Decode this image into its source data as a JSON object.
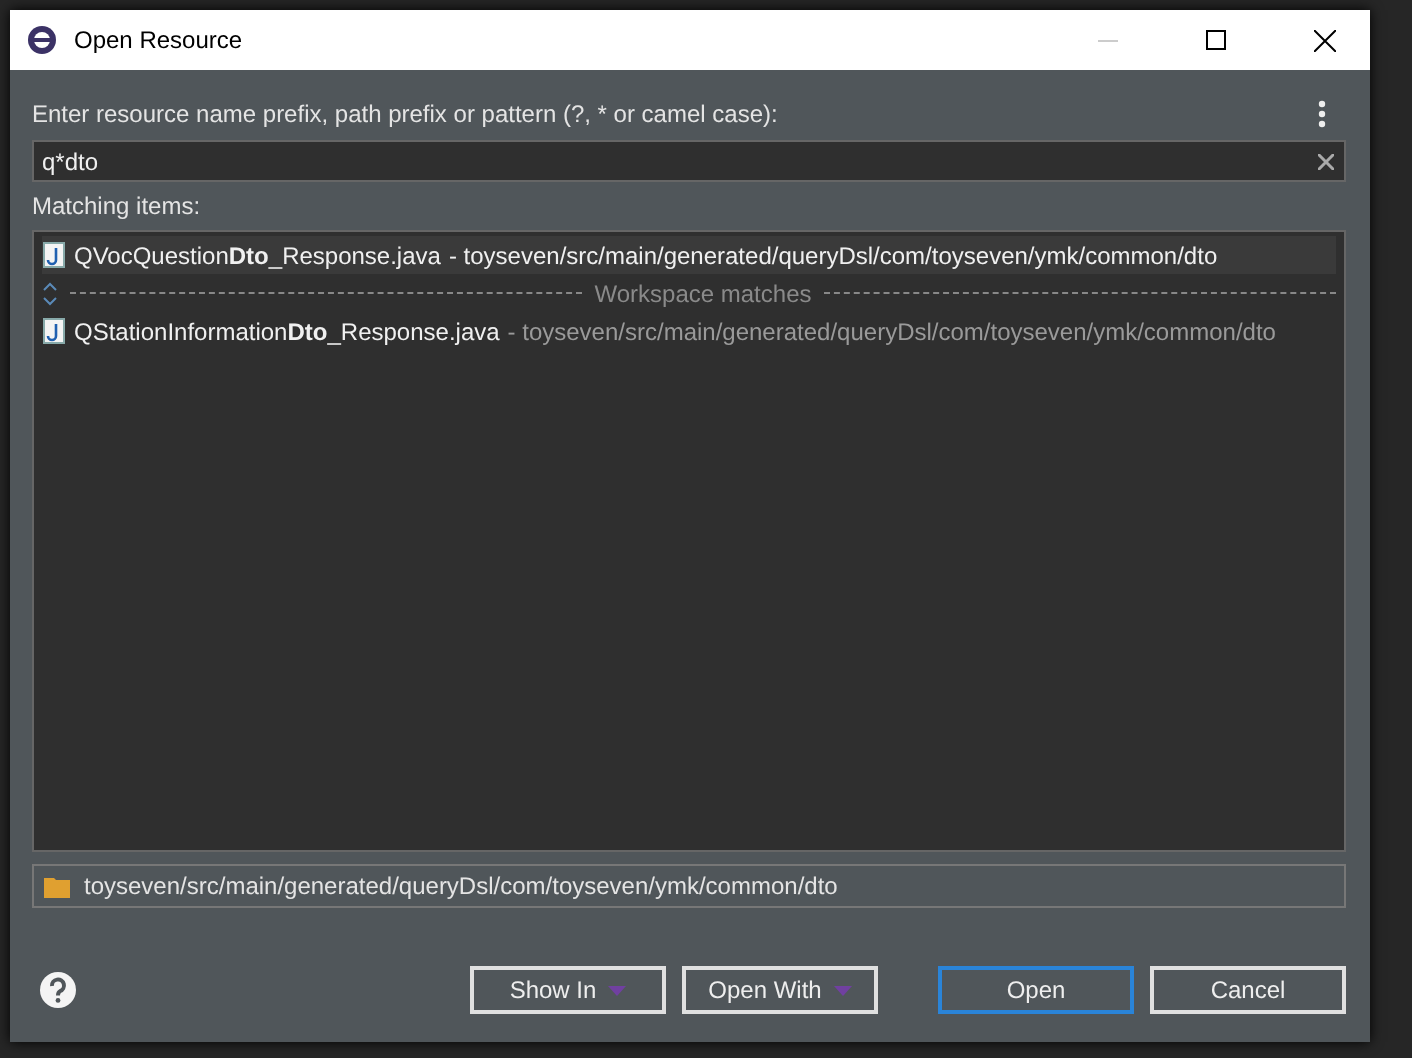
{
  "window": {
    "title": "Open Resource"
  },
  "prompt": "Enter resource name prefix, path prefix or pattern (?, * or camel case):",
  "search": {
    "value": "q*dto"
  },
  "matching_label": "Matching items:",
  "items": [
    {
      "kind": "match",
      "name": "QVocQuestion**Dto**_Response.java",
      "path": "- toyseven/src/main/generated/queryDsl/com/toyseven/ymk/common/dto",
      "selected": true
    },
    {
      "kind": "separator",
      "label": "Workspace matches"
    },
    {
      "kind": "match",
      "name": "QStationInformation**Dto**_Response.java",
      "path": "- toyseven/src/main/generated/queryDsl/com/toyseven/ymk/common/dto",
      "selected": false
    }
  ],
  "location": "toyseven/src/main/generated/queryDsl/com/toyseven/ymk/common/dto",
  "buttons": [
    {
      "label": "Show In",
      "kind": "menu",
      "default": false
    },
    {
      "label": "Open With",
      "kind": "menu",
      "default": false
    },
    {
      "label": "Open",
      "kind": "plain",
      "default": true
    },
    {
      "label": "Cancel",
      "kind": "plain",
      "default": false
    }
  ]
}
